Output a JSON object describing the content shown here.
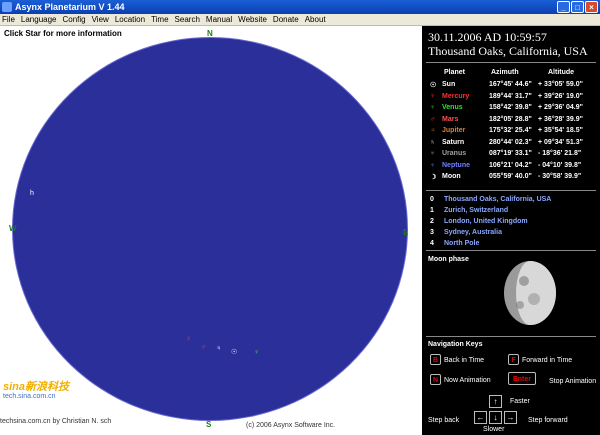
{
  "window": {
    "title": "Asynx Planetarium V 1.44"
  },
  "menu": [
    "File",
    "Language",
    "Config",
    "View",
    "Location",
    "Time",
    "Search",
    "Manual",
    "Website",
    "Donate",
    "About"
  ],
  "sky": {
    "hint": "Click Star for more information",
    "compass": {
      "n": "N",
      "w": "W",
      "e": "E",
      "s": "S"
    },
    "object_label": "h",
    "footer_left": "techsina.com.cn by Christian N. sch",
    "footer_right": "(c) 2006 Asynx Software Inc."
  },
  "watermark": {
    "logo": "sina新浪科技",
    "url": "tech.sina.com.cn"
  },
  "panel": {
    "date": "30.11.2006 AD  10:59:57",
    "location": "Thousand Oaks, California, USA",
    "headers": {
      "planet": "Planet",
      "azimuth": "Azimuth",
      "altitude": "Altitude"
    },
    "planets": [
      {
        "symbol": "☉",
        "name": "Sun",
        "az": "167°45' 44.6\"",
        "alt": "+ 33°05' 59.0\"",
        "color": "#ffffff"
      },
      {
        "symbol": "☿",
        "name": "Mercury",
        "az": "189°44' 31.7\"",
        "alt": "+ 39°26' 19.0\"",
        "color": "#ff3030"
      },
      {
        "symbol": "♀",
        "name": "Venus",
        "az": "158°42' 39.8\"",
        "alt": "+ 29°36' 04.9\"",
        "color": "#30e030"
      },
      {
        "symbol": "♂",
        "name": "Mars",
        "az": "182°05' 28.8\"",
        "alt": "+ 36°28' 39.9\"",
        "color": "#ff5050"
      },
      {
        "symbol": "♃",
        "name": "Jupiter",
        "az": "175°32' 25.4\"",
        "alt": "+ 35°54' 18.5\"",
        "color": "#d08040"
      },
      {
        "symbol": "♄",
        "name": "Saturn",
        "az": "280°44' 02.3\"",
        "alt": "+ 09°34' 51.3\"",
        "color": "#ffffff"
      },
      {
        "symbol": "♅",
        "name": "Uranus",
        "az": "087°19' 33.1\"",
        "alt": "-  18°36' 21.8\"",
        "color": "#a0a0a0"
      },
      {
        "symbol": "♆",
        "name": "Neptune",
        "az": "106°21' 04.2\"",
        "alt": "-  04°10' 39.8\"",
        "color": "#7080ff"
      },
      {
        "symbol": "☽",
        "name": "Moon",
        "az": "055°59' 40.0\"",
        "alt": "-  30°58' 39.9\"",
        "color": "#ffffff"
      }
    ],
    "locations": [
      {
        "n": "0",
        "name": "Thousand Oaks, California, USA"
      },
      {
        "n": "1",
        "name": "Zurich, Switzerland"
      },
      {
        "n": "2",
        "name": "London, United Kingdom"
      },
      {
        "n": "3",
        "name": "Sydney, Australia"
      },
      {
        "n": "4",
        "name": "North Pole"
      }
    ],
    "moon_title": "Moon phase",
    "nav": {
      "title": "Navigation Keys",
      "back_key": "B",
      "back_label": "Back in Time",
      "forward_key": "F",
      "forward_label": "Forward in Time",
      "now_key": "N",
      "now_label": "Now Animation",
      "enter_key": "Enter",
      "stop_label": "Stop Animation",
      "faster": "Faster",
      "slower": "Slower",
      "step_back": "Step back",
      "step_forward": "Step forward",
      "up": "↑",
      "down": "↓",
      "left": "←",
      "right": "→"
    }
  }
}
